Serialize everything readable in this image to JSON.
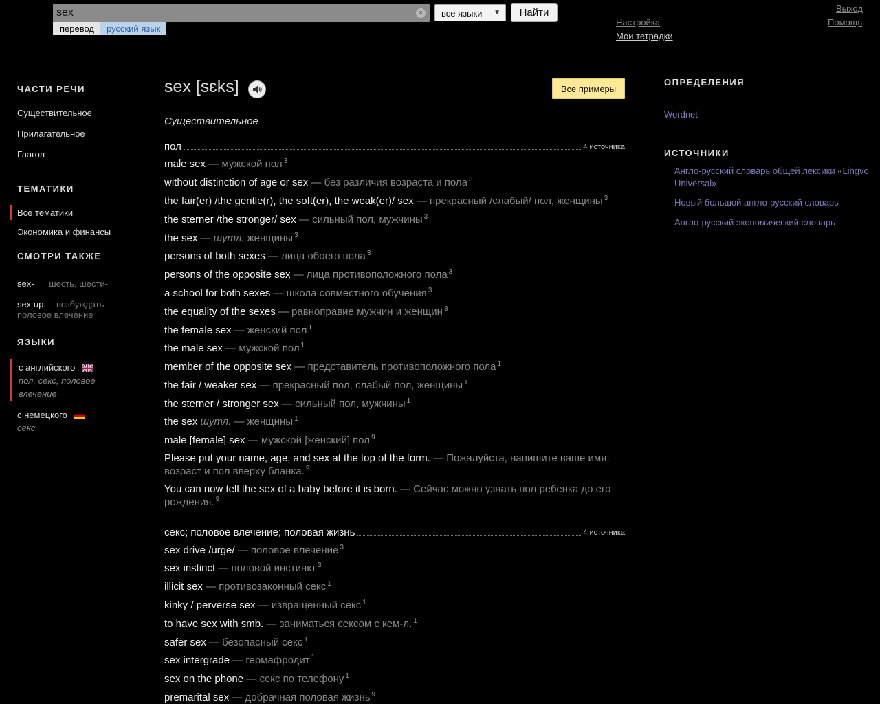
{
  "header": {
    "search_value": "sex",
    "clear_glyph": "×",
    "tab_translate": "перевод",
    "tab_language": "русский язык",
    "lang_select_value": "все языки",
    "lang_arrow": "▼",
    "find_label": "Найти",
    "settings": "Настройка",
    "notebooks": "Мои тетрадки",
    "logout": "Выход",
    "help": "Помощь"
  },
  "left": {
    "pos_title": "ЧАСТИ РЕЧИ",
    "pos_items": [
      "Существительное",
      "Прилагательное",
      "Глагол"
    ],
    "topics_title": "ТЕМАТИКИ",
    "topics": [
      "Все тематики",
      "Экономика и финансы"
    ],
    "see_also_title": "СМОТРИ ТАКЖЕ",
    "see_also": [
      {
        "word": "sex-",
        "desc": "шесть, шести-"
      },
      {
        "word": "sex up",
        "desc": "возбуждать половое влечение"
      }
    ],
    "languages_title": "ЯЗЫКИ",
    "languages": [
      {
        "name": "с английского",
        "translation": "пол, секс, половое влечение"
      },
      {
        "name": "с немецкого",
        "translation": "секс"
      }
    ]
  },
  "main": {
    "headword": "sex [sɛks]",
    "all_examples": "Все примеры",
    "pos": "Существительное",
    "meanings": [
      {
        "title": "пол",
        "sources": "4 источника"
      },
      {
        "title": "секс; половое влечение; половая жизнь",
        "sources": "4 источника"
      }
    ],
    "examples": [
      {
        "en": "male sex",
        "label": "",
        "ru": "мужской пол",
        "n": "3"
      },
      {
        "en": "without distinction of age or sex",
        "label": "",
        "ru": "без различия возраста и пола",
        "n": "3"
      },
      {
        "en": "the fair(er) /the gentle(r), the soft(er), the weak(er)/ sex",
        "label": "",
        "ru": "прекрасный /слабый/ пол, женщины",
        "n": "3"
      },
      {
        "en": "the sterner /the stronger/ sex",
        "label": "",
        "ru": "сильный пол, мужчины",
        "n": "3"
      },
      {
        "en": "the sex",
        "label": "шутл.",
        "ru": "женщины",
        "n": "3"
      },
      {
        "en": "persons of both sexes",
        "label": "",
        "ru": "лица обоего пола",
        "n": "3"
      },
      {
        "en": "persons of the opposite sex",
        "label": "",
        "ru": "лица противоположного пола",
        "n": "3"
      },
      {
        "en": "a school for both sexes",
        "label": "",
        "ru": "школа совместного обучения",
        "n": "3"
      },
      {
        "en": "the equality of the sexes",
        "label": "",
        "ru": "равноправие мужчин и женщин",
        "n": "3"
      },
      {
        "en": "the female sex",
        "label": "",
        "ru": "женский пол",
        "n": "1"
      },
      {
        "en": "the male sex",
        "label": "",
        "ru": "мужской пол",
        "n": "1"
      },
      {
        "en": "member of the opposite sex",
        "label": "",
        "ru": "представитель противоположного пола",
        "n": "1"
      },
      {
        "en": "the fair / weaker sex",
        "label": "",
        "ru": "прекрасный пол, слабый пол, женщины",
        "n": "1"
      },
      {
        "en": "the sterner / stronger sex",
        "label": "",
        "ru": "сильный пол, мужчины",
        "n": "1"
      },
      {
        "en": "the sex",
        "label": "шутл.",
        "ru": "женщины",
        "n": "1",
        "label_before_dash": true
      },
      {
        "en": "male [female] sex",
        "label": "",
        "ru": "мужской [женский] пол",
        "n": "9"
      },
      {
        "en": "Please put your name, age, and sex at the top of the form.",
        "label": "",
        "ru": "Пожалуйста, напишите ваше имя, возраст и пол вверху бланка.",
        "n": "9"
      },
      {
        "en": "You can now tell the sex of a baby before it is born.",
        "label": "",
        "ru": "Сейчас можно узнать пол ребенка до его рождения.",
        "n": "9"
      }
    ],
    "examples2": [
      {
        "en": "sex drive /urge/",
        "ru": "половое влечение",
        "n": "3"
      },
      {
        "en": "sex instinct",
        "ru": "половой инстинкт",
        "n": "3"
      },
      {
        "en": "illicit sex",
        "ru": "противозаконный секс",
        "n": "1"
      },
      {
        "en": "kinky / perverse sex",
        "ru": "извращенный секс",
        "n": "1"
      },
      {
        "en": "to have sex with smb.",
        "ru": "заниматься сексом с кем-л.",
        "n": "1"
      },
      {
        "en": "safer sex",
        "ru": "безопасный секс",
        "n": "1"
      },
      {
        "en": "sex intergrade",
        "ru": "гермафродит",
        "n": "1"
      },
      {
        "en": "sex on the phone",
        "ru": "секс по телефону",
        "n": "1"
      },
      {
        "en": "premarital sex",
        "ru": "добрачная половая жизнь",
        "n": "9"
      }
    ]
  },
  "right": {
    "definitions_title": "ОПРЕДЕЛЕНИЯ",
    "wordnet": "Wordnet",
    "sources_title": "ИСТОЧНИКИ",
    "sources": [
      "Англо-русский словарь общей лексики «Lingvo Universal»",
      "Новый большой англо-русский словарь",
      "Англо-русский экономический словарь"
    ]
  }
}
